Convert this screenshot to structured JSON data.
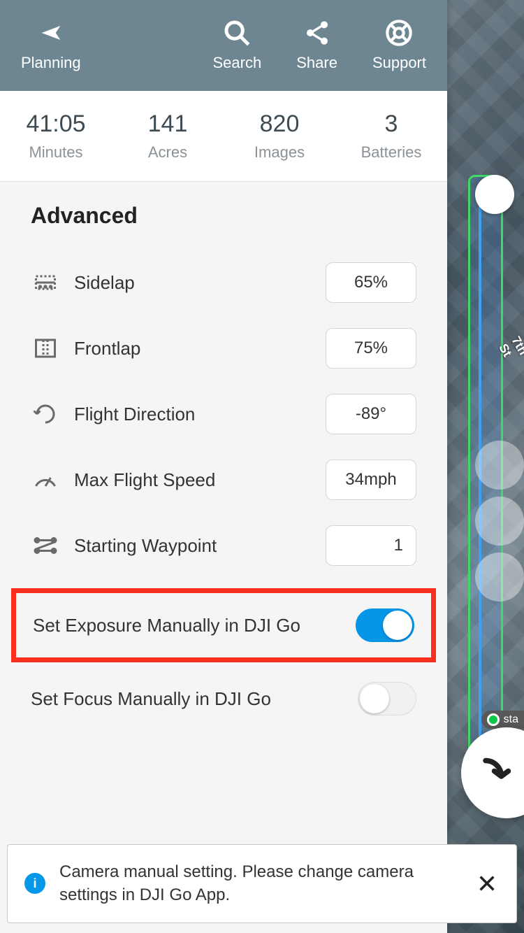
{
  "header": {
    "planning": "Planning",
    "search": "Search",
    "share": "Share",
    "support": "Support"
  },
  "stats": {
    "minutes": {
      "value": "41:05",
      "label": "Minutes"
    },
    "acres": {
      "value": "141",
      "label": "Acres"
    },
    "images": {
      "value": "820",
      "label": "Images"
    },
    "batteries": {
      "value": "3",
      "label": "Batteries"
    }
  },
  "section": {
    "title": "Advanced",
    "sidelap": {
      "label": "Sidelap",
      "value": "65%"
    },
    "frontlap": {
      "label": "Frontlap",
      "value": "75%"
    },
    "direction": {
      "label": "Flight Direction",
      "value": "-89°"
    },
    "speed": {
      "label": "Max Flight Speed",
      "value": "34mph"
    },
    "waypoint": {
      "label": "Starting Waypoint",
      "value": "1"
    },
    "exposure": {
      "label": "Set Exposure Manually in DJI Go",
      "on": true
    },
    "focus": {
      "label": "Set Focus Manually in DJI Go",
      "on": false
    }
  },
  "toast": {
    "text": "Camera manual setting. Please change camera settings in DJI Go App."
  },
  "map": {
    "street": "7th St",
    "sta": "sta"
  }
}
